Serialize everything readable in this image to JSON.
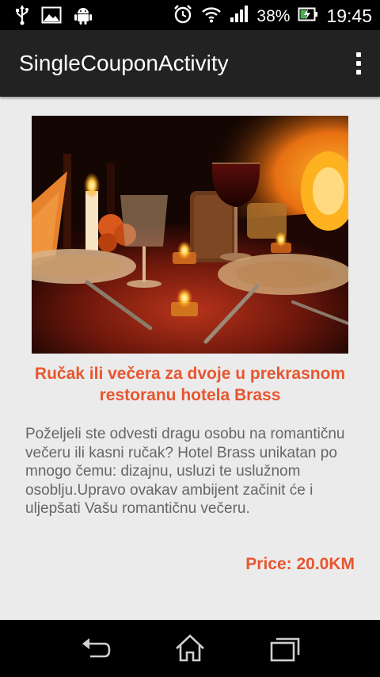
{
  "status_bar": {
    "battery": "38%",
    "time": "19:45",
    "icons": [
      "usb-icon",
      "image-icon",
      "android-icon",
      "alarm-clock-icon",
      "wifi-icon",
      "signal-icon",
      "battery-charging-icon"
    ]
  },
  "action_bar": {
    "title": "SingleCouponActivity",
    "overflow_icon": "more-vertical-icon"
  },
  "coupon": {
    "title": "Ručak ili večera za dvoje u prekrasnom restoranu hotela Brass",
    "description": "Poželjeli ste odvesti dragu osobu na romantičnu večeru ili kasni ručak? Hotel Brass unikatan po mnogo čemu: dizajnu, usluzi te uslužnom osoblju.Upravo ovakav ambijent začinit će i uljepšati Vašu romantičnu večeru.",
    "price": "Price: 20.0KM",
    "accent_color": "#e8562f"
  },
  "nav_bar": {
    "icons": [
      "back-icon",
      "home-icon",
      "recent-apps-icon"
    ]
  }
}
